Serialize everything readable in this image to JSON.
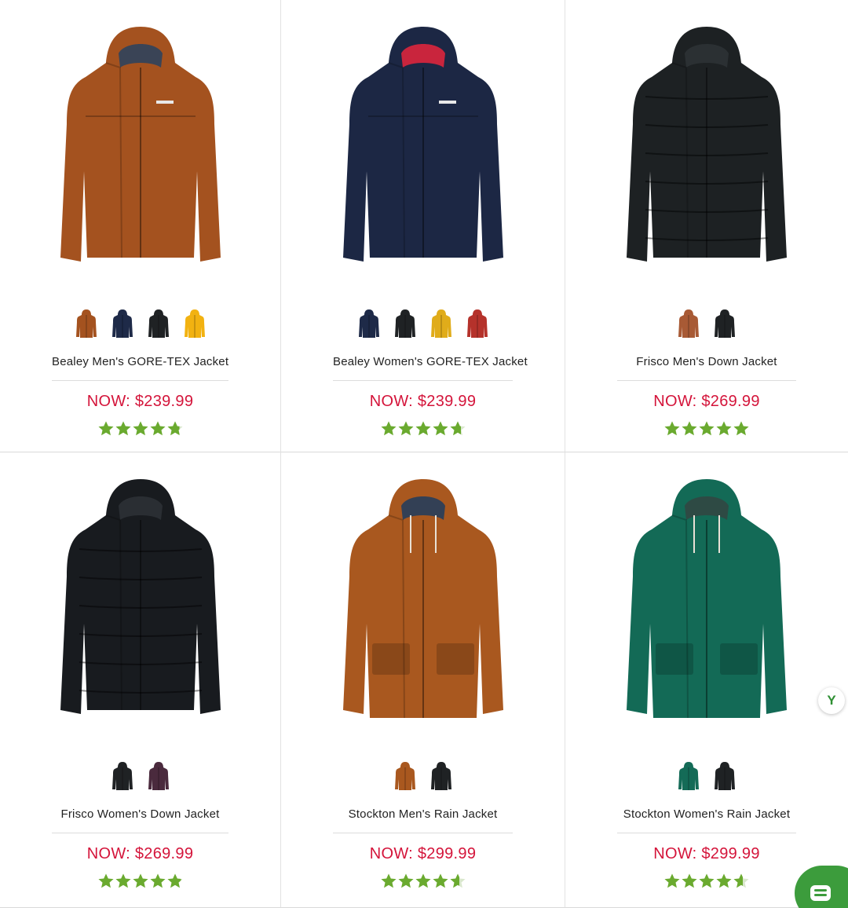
{
  "products": [
    {
      "name": "Bealey Men's GORE-TEX Jacket",
      "price": "NOW: $239.99",
      "rating": 4.8,
      "jacket_style": "shell",
      "main_color": "#a4521f",
      "accent_color": "#3a4456",
      "swatches": [
        {
          "name": "rust",
          "color": "#a4521f"
        },
        {
          "name": "navy",
          "color": "#1e2a48"
        },
        {
          "name": "black",
          "color": "#1f2224"
        },
        {
          "name": "yellow",
          "color": "#f2b211"
        }
      ]
    },
    {
      "name": "Bealey Women's GORE-TEX Jacket",
      "price": "NOW: $239.99",
      "rating": 4.7,
      "jacket_style": "shell",
      "main_color": "#1c2744",
      "accent_color": "#c9253d",
      "swatches": [
        {
          "name": "navy",
          "color": "#1e2a48"
        },
        {
          "name": "black",
          "color": "#1f2224"
        },
        {
          "name": "yellow",
          "color": "#e0ac1a"
        },
        {
          "name": "red",
          "color": "#b5322b"
        }
      ]
    },
    {
      "name": "Frisco Men's Down Jacket",
      "price": "NOW: $269.99",
      "rating": 5,
      "jacket_style": "puffer",
      "main_color": "#1d2123",
      "accent_color": "#2b3033",
      "swatches": [
        {
          "name": "rust",
          "color": "#a85a35"
        },
        {
          "name": "black",
          "color": "#1f2224"
        }
      ]
    },
    {
      "name": "Frisco Women's Down Jacket",
      "price": "NOW: $269.99",
      "rating": 4.9,
      "jacket_style": "puffer",
      "main_color": "#181b1f",
      "accent_color": "#2a2e33",
      "swatches": [
        {
          "name": "black",
          "color": "#1f2224"
        },
        {
          "name": "plum",
          "color": "#4a2a3d"
        }
      ]
    },
    {
      "name": "Stockton Men's Rain Jacket",
      "price": "NOW: $299.99",
      "rating": 4.6,
      "jacket_style": "parka",
      "main_color": "#a9581f",
      "accent_color": "#334055",
      "swatches": [
        {
          "name": "rust",
          "color": "#a9581f"
        },
        {
          "name": "black",
          "color": "#1f2224"
        }
      ]
    },
    {
      "name": "Stockton Women's Rain Jacket",
      "price": "NOW: $299.99",
      "rating": 4.6,
      "jacket_style": "parka",
      "main_color": "#136a56",
      "accent_color": "#2e4a44",
      "swatches": [
        {
          "name": "green",
          "color": "#146b57"
        },
        {
          "name": "black",
          "color": "#1f2224"
        }
      ]
    }
  ],
  "star_color": "#6aaa2f",
  "star_empty_color": "#d9e7cc",
  "price_color": "#d4143a",
  "mini_fab_label": "Y",
  "chat_fab_color": "#3c9c3c"
}
